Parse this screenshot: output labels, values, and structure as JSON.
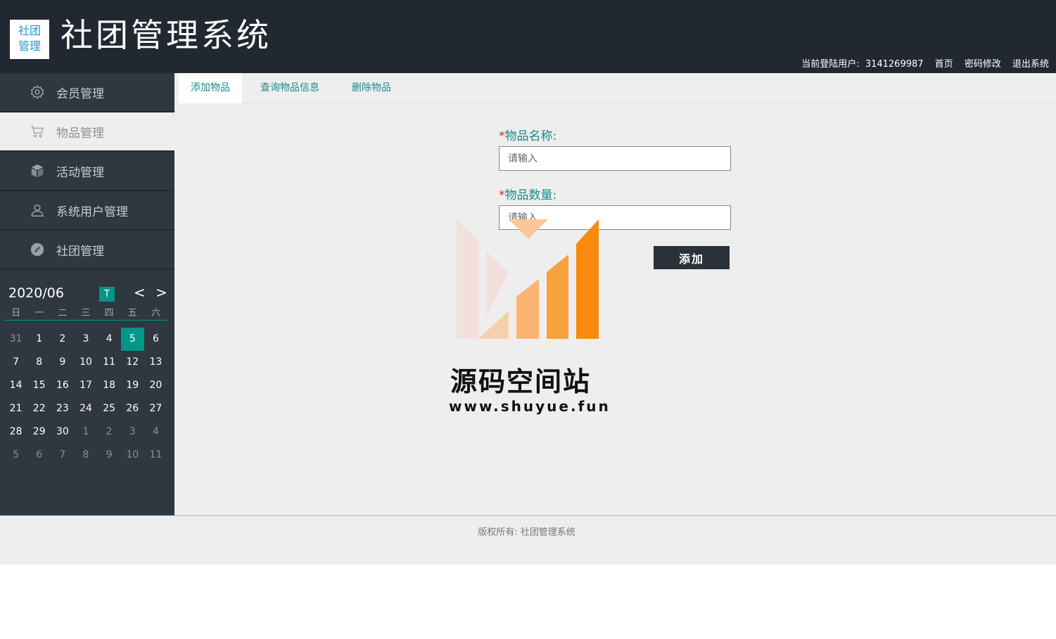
{
  "header": {
    "logo_line1": "社团",
    "logo_line2": "管理",
    "title": "社团管理系统",
    "user_label": "当前登陆用户:",
    "user_id": "3141269987",
    "links": [
      "首页",
      "密码修改",
      "退出系统"
    ]
  },
  "sidebar": {
    "items": [
      {
        "label": "会员管理",
        "icon": "gear-icon"
      },
      {
        "label": "物品管理",
        "icon": "cart-icon"
      },
      {
        "label": "活动管理",
        "icon": "cube-icon"
      },
      {
        "label": "系统用户管理",
        "icon": "user-icon"
      },
      {
        "label": "社团管理",
        "icon": "compass-icon"
      }
    ],
    "active_index": 1
  },
  "calendar": {
    "month": "2020/06",
    "today_btn": "T",
    "prev": "<",
    "next": ">",
    "weekdays": [
      "日",
      "一",
      "二",
      "三",
      "四",
      "五",
      "六"
    ],
    "weeks": [
      [
        "31",
        "1",
        "2",
        "3",
        "4",
        "5",
        "6"
      ],
      [
        "7",
        "8",
        "9",
        "10",
        "11",
        "12",
        "13"
      ],
      [
        "14",
        "15",
        "16",
        "17",
        "18",
        "19",
        "20"
      ],
      [
        "21",
        "22",
        "23",
        "24",
        "25",
        "26",
        "27"
      ],
      [
        "28",
        "29",
        "30",
        "1",
        "2",
        "3",
        "4"
      ],
      [
        "5",
        "6",
        "7",
        "8",
        "9",
        "10",
        "11"
      ]
    ],
    "selected": "5",
    "accent_color": "#009688"
  },
  "tabs": [
    "添加物品",
    "查询物品信息",
    "删除物品"
  ],
  "form": {
    "required_mark": "*",
    "name_label": "物品名称:",
    "name_placeholder": "请输入",
    "qty_label": "物品数量:",
    "qty_placeholder": "请输入",
    "submit_label": "添加"
  },
  "watermark": {
    "title": "源码空间站",
    "url": "www.shuyue.fun"
  },
  "footer": {
    "copyright": "版权所有: 社团管理系统"
  }
}
